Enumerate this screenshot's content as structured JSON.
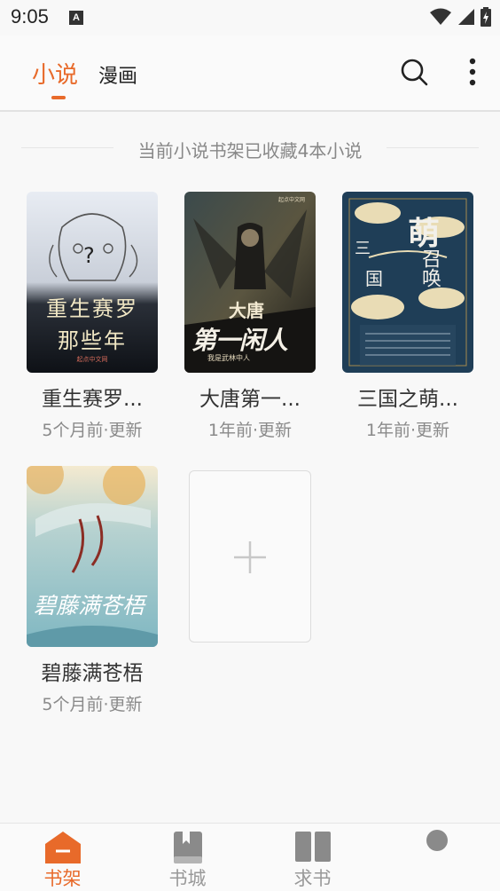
{
  "status_bar": {
    "time": "9:05",
    "notification_letter": "A"
  },
  "top_bar": {
    "tabs": [
      {
        "label": "小说",
        "active": true
      },
      {
        "label": "漫画",
        "active": false
      }
    ],
    "search_icon": "search-icon",
    "more_icon": "more-vertical-icon"
  },
  "shelf": {
    "summary": "当前小说书架已收藏4本小说",
    "books": [
      {
        "title": "重生赛罗...",
        "updated": "5个月前·更新",
        "cover_text_1": "重生赛罗",
        "cover_text_2": "那些年",
        "cover_publisher": "起点中文网"
      },
      {
        "title": "大唐第一...",
        "updated": "1年前·更新",
        "cover_text_1": "大唐",
        "cover_text_2": "第一闲人",
        "cover_author": "我是武林中人",
        "cover_publisher": "起点中文网"
      },
      {
        "title": "三国之萌...",
        "updated": "1年前·更新",
        "cover_text_1": "萌",
        "cover_text_2": "召唤",
        "cover_text_3": "三",
        "cover_text_4": "国"
      },
      {
        "title": "碧藤满苍梧",
        "updated": "5个月前·更新",
        "cover_text_1": "碧藤满苍梧"
      }
    ],
    "add_icon": "plus-icon"
  },
  "bottom_nav": {
    "items": [
      {
        "label": "书架",
        "icon": "bookshelf-icon",
        "active": true
      },
      {
        "label": "书城",
        "icon": "book-icon",
        "active": false
      },
      {
        "label": "求书",
        "icon": "open-book-icon",
        "active": false
      },
      {
        "label": "",
        "icon": "profile-dot-icon",
        "active": false
      }
    ]
  },
  "colors": {
    "accent": "#e86a2a",
    "inactive": "#999999",
    "background": "#f8f8f8"
  }
}
